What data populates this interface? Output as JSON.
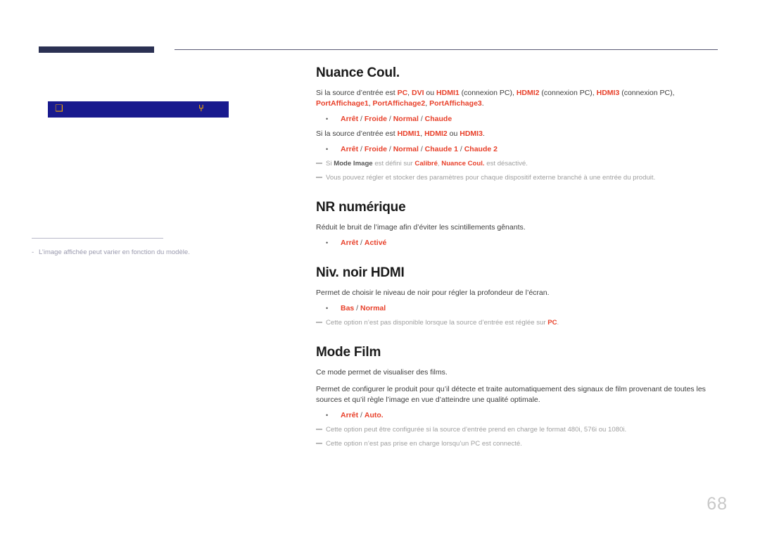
{
  "page": {
    "number": "68"
  },
  "header": {
    "rule_color": "#2b3153",
    "line_color": "#5a5a74"
  },
  "left_column": {
    "panel": {
      "background": "#191a8e",
      "glyph_left": "❑",
      "glyph_right": "⑂",
      "glyph_color": "#f5a800"
    },
    "note": {
      "dash": "-",
      "text": "L’image affichée peut varier en fonction du modèle."
    }
  },
  "sections": [
    {
      "title": "Nuance Coul.",
      "paragraphs": [
        {
          "runs": [
            {
              "t": "Si la source d’entrée est ",
              "s": "plain"
            },
            {
              "t": "PC",
              "s": "accent"
            },
            {
              "t": ", ",
              "s": "plain"
            },
            {
              "t": "DVI",
              "s": "accent"
            },
            {
              "t": " ou ",
              "s": "plain"
            },
            {
              "t": "HDMI1",
              "s": "accent"
            },
            {
              "t": " (connexion PC), ",
              "s": "plain"
            },
            {
              "t": "HDMI2",
              "s": "accent"
            },
            {
              "t": " (connexion PC), ",
              "s": "plain"
            },
            {
              "t": "HDMI3",
              "s": "accent"
            },
            {
              "t": " (connexion PC), ",
              "s": "plain"
            },
            {
              "t": "PortAffichage1",
              "s": "accent"
            },
            {
              "t": ", ",
              "s": "plain"
            },
            {
              "t": "PortAffichage2",
              "s": "accent"
            },
            {
              "t": ", ",
              "s": "plain"
            },
            {
              "t": "PortAffichage3",
              "s": "accent"
            },
            {
              "t": ".",
              "s": "plain"
            }
          ]
        }
      ],
      "options": [
        "Arrêt / Froide / Normal / Chaude"
      ],
      "paragraphs2": [
        {
          "runs": [
            {
              "t": "Si la source d’entrée est ",
              "s": "plain"
            },
            {
              "t": "HDMI1",
              "s": "accent"
            },
            {
              "t": ", ",
              "s": "plain"
            },
            {
              "t": "HDMI2",
              "s": "accent"
            },
            {
              "t": " ou ",
              "s": "plain"
            },
            {
              "t": "HDMI3",
              "s": "accent"
            },
            {
              "t": ".",
              "s": "plain"
            }
          ]
        }
      ],
      "options2": [
        "Arrêt / Froide / Normal / Chaude 1 / Chaude 2"
      ],
      "notes": [
        {
          "runs": [
            {
              "t": "Si ",
              "s": "gray"
            },
            {
              "t": "Mode Image",
              "s": "dark"
            },
            {
              "t": " est défini sur ",
              "s": "gray"
            },
            {
              "t": "Calibré",
              "s": "accent"
            },
            {
              "t": ", ",
              "s": "gray"
            },
            {
              "t": "Nuance Coul.",
              "s": "accent"
            },
            {
              "t": " est désactivé.",
              "s": "gray"
            }
          ]
        },
        {
          "runs": [
            {
              "t": "Vous pouvez régler et stocker des paramètres pour chaque dispositif externe branché à une entrée du produit.",
              "s": "gray"
            }
          ]
        }
      ]
    },
    {
      "title": "NR numérique",
      "paragraphs": [
        {
          "runs": [
            {
              "t": "Réduit le bruit de l’image afin d’éviter les scintillements gênants.",
              "s": "plain"
            }
          ]
        }
      ],
      "options": [
        "Arrêt /Activé"
      ],
      "notes": []
    },
    {
      "title": "Niv. noir HDMI",
      "paragraphs": [
        {
          "runs": [
            {
              "t": "Permet de choisir le niveau de noir pour régler la profondeur de l’écran.",
              "s": "plain"
            }
          ]
        }
      ],
      "options": [
        "Bas / Normal"
      ],
      "notes": [
        {
          "runs": [
            {
              "t": "Cette option n’est pas disponible lorsque la source d’entrée est réglée sur ",
              "s": "gray"
            },
            {
              "t": "PC",
              "s": "accent"
            },
            {
              "t": ".",
              "s": "gray"
            }
          ]
        }
      ]
    },
    {
      "title": "Mode Film",
      "paragraphs": [
        {
          "runs": [
            {
              "t": "Ce mode permet de visualiser des films.",
              "s": "plain"
            }
          ]
        },
        {
          "runs": [
            {
              "t": "Permet de configurer le produit pour qu’il détecte et traite automatiquement des signaux de film provenant de toutes les sources et qu’il règle l’image en vue d’atteindre une qualité optimale.",
              "s": "plain"
            }
          ]
        }
      ],
      "options": [
        "Arrêt / Auto."
      ],
      "notes": [
        {
          "runs": [
            {
              "t": "Cette option peut être configurée si la source d’entrée prend en charge le format 480i, 576i ou 1080i.",
              "s": "gray"
            }
          ]
        },
        {
          "runs": [
            {
              "t": "Cette option n’est pas prise en charge lorsqu’un PC est connecté.",
              "s": "gray"
            }
          ]
        }
      ]
    }
  ]
}
